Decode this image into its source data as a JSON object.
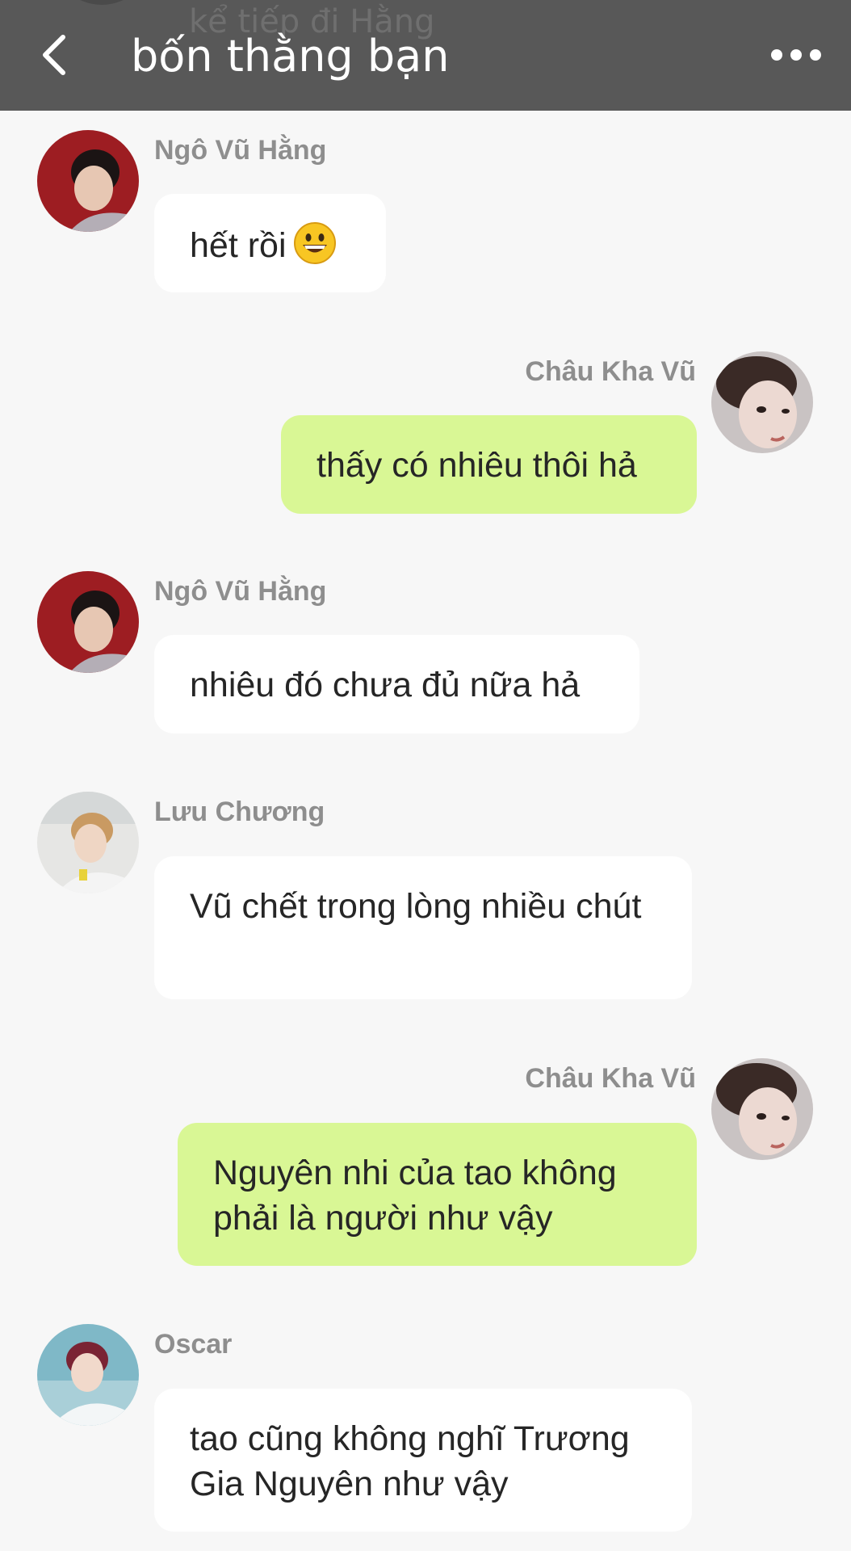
{
  "header": {
    "title": "bốn thằng bạn",
    "peek_text": "kể tiếp đi Hằng",
    "back_icon": "chevron-left-icon",
    "more_icon": "more-horizontal-icon"
  },
  "colors": {
    "header_bg": "#585858",
    "page_bg": "#f7f7f7",
    "incoming_bubble": "#ffffff",
    "outgoing_bubble": "#d9f795",
    "sender_name": "#8e8e8e"
  },
  "messages": [
    {
      "sender": "Ngô Vũ Hằng",
      "text": "hết rồi",
      "emoji": "grinning-face-icon",
      "direction": "incoming"
    },
    {
      "sender": "Châu Kha Vũ",
      "text": "thấy có nhiêu thôi hả",
      "direction": "outgoing"
    },
    {
      "sender": "Ngô Vũ Hằng",
      "text": "nhiêu đó chưa đủ nữa hả",
      "direction": "incoming"
    },
    {
      "sender": "Lưu Chương",
      "text": "Vũ chết trong lòng nhiều chút",
      "direction": "incoming"
    },
    {
      "sender": "Châu Kha Vũ",
      "text": "Nguyên nhi của tao không phải là người như vậy",
      "direction": "outgoing"
    },
    {
      "sender": "Oscar",
      "text": "tao cũng không nghĩ Trương Gia Nguyên như vậy",
      "direction": "incoming"
    }
  ]
}
